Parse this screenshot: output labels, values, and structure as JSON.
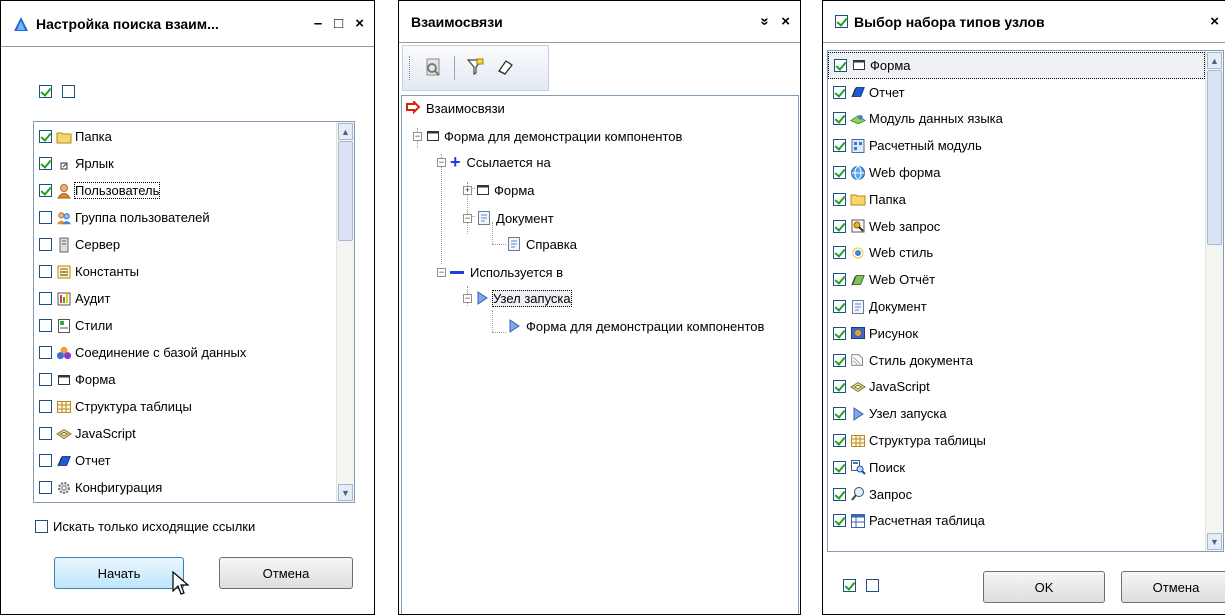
{
  "panel1": {
    "title": "Настройка поиска взаим...",
    "title_buttons": [
      "–",
      "□",
      "×"
    ],
    "items": [
      {
        "label": "Папка",
        "checked": true,
        "icon": "folder-icon"
      },
      {
        "label": "Ярлык",
        "checked": true,
        "icon": "shortcut-icon"
      },
      {
        "label": "Пользователь",
        "checked": true,
        "icon": "user-icon"
      },
      {
        "label": "Группа пользователей",
        "checked": false,
        "icon": "user-group-icon"
      },
      {
        "label": "Сервер",
        "checked": false,
        "icon": "server-icon"
      },
      {
        "label": "Константы",
        "checked": false,
        "icon": "constants-icon"
      },
      {
        "label": "Аудит",
        "checked": false,
        "icon": "audit-icon"
      },
      {
        "label": "Стили",
        "checked": false,
        "icon": "styles-icon"
      },
      {
        "label": "Соединение с базой данных",
        "checked": false,
        "icon": "database-connection-icon"
      },
      {
        "label": "Форма",
        "checked": false,
        "icon": "form-icon"
      },
      {
        "label": "Структура таблицы",
        "checked": false,
        "icon": "table-structure-icon"
      },
      {
        "label": "JavaScript",
        "checked": false,
        "icon": "javascript-icon"
      },
      {
        "label": "Отчет",
        "checked": false,
        "icon": "report-icon"
      },
      {
        "label": "Конфигурация",
        "checked": false,
        "icon": "configuration-icon"
      }
    ],
    "outgoing_only_label": "Искать только исходящие ссылки",
    "start_button": "Начать",
    "cancel_button": "Отмена"
  },
  "panel2": {
    "title": "Взаимосвязи",
    "title_buttons": [
      "»",
      "×"
    ],
    "tree": {
      "root": "Взаимосвязи",
      "form_node": "Форма для демонстрации компонентов",
      "refers_to": "Ссылается на",
      "form_child": "Форма",
      "document": "Документ",
      "help": "Справка",
      "used_in": "Используется в",
      "launch_node": "Узел запуска",
      "launch_child": "Форма для демонстрации компонентов"
    }
  },
  "panel3": {
    "title": "Выбор набора типов узлов",
    "items": [
      {
        "label": "Форма",
        "icon": "form-icon"
      },
      {
        "label": "Отчет",
        "icon": "report-icon"
      },
      {
        "label": "Модуль данных языка",
        "icon": "language-data-module-icon"
      },
      {
        "label": "Расчетный модуль",
        "icon": "calc-module-icon"
      },
      {
        "label": "Web форма",
        "icon": "web-form-icon"
      },
      {
        "label": "Папка",
        "icon": "folder-icon"
      },
      {
        "label": "Web запрос",
        "icon": "web-query-icon"
      },
      {
        "label": "Web стиль",
        "icon": "web-style-icon"
      },
      {
        "label": "Web Отчёт",
        "icon": "web-report-icon"
      },
      {
        "label": "Документ",
        "icon": "document-icon"
      },
      {
        "label": "Рисунок",
        "icon": "picture-icon"
      },
      {
        "label": "Стиль документа",
        "icon": "document-style-icon"
      },
      {
        "label": "JavaScript",
        "icon": "javascript-icon"
      },
      {
        "label": "Узел запуска",
        "icon": "launch-node-icon"
      },
      {
        "label": "Структура таблицы",
        "icon": "table-structure-icon"
      },
      {
        "label": "Поиск",
        "icon": "search-icon"
      },
      {
        "label": "Запрос",
        "icon": "query-icon"
      },
      {
        "label": "Расчетная таблица",
        "icon": "calc-table-icon"
      }
    ],
    "ok_button": "OK",
    "cancel_button": "Отмена"
  }
}
